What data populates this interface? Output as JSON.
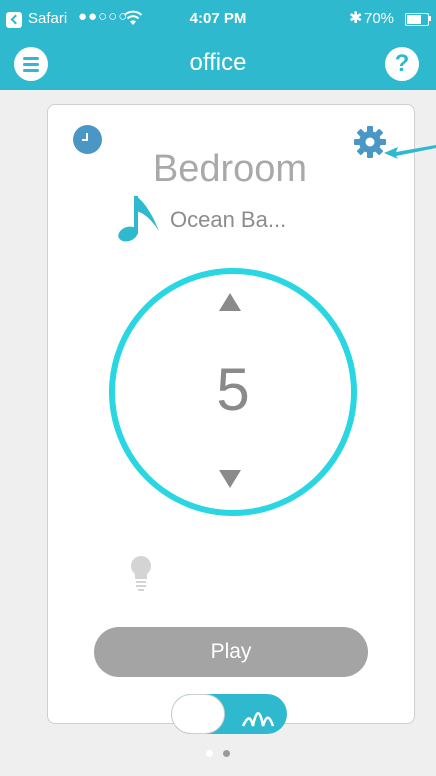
{
  "status_bar": {
    "app": "Safari",
    "signal": "●●○○○",
    "time": "4:07 PM",
    "bluetooth": "✱",
    "battery_text": "70%",
    "battery_level": 0.7
  },
  "nav": {
    "title": "office",
    "menu_icon": "hamburger-menu-icon",
    "help_label": "?"
  },
  "card": {
    "room_name": "Bedroom",
    "track": "Ocean Ba...",
    "volume": "5",
    "play_label": "Play",
    "timer_icon": "clock-icon",
    "settings_icon": "gear-icon",
    "light_icon": "light-bulb-icon",
    "mode_icon": "sound-wave-icon",
    "toggle_on": true
  },
  "pager": {
    "pages": 2,
    "active": 0
  },
  "colors": {
    "accent": "#2fb9cf",
    "dial": "#2ad6e2",
    "clock": "#4a97c6",
    "play_button": "#a4a4a4",
    "text_gray": "#a9a9a9"
  }
}
